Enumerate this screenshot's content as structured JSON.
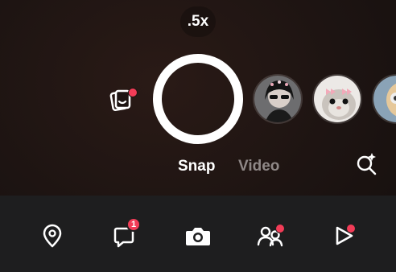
{
  "camera": {
    "zoom_label": ".5x",
    "modes": {
      "snap": "Snap",
      "video": "Video",
      "active": "Snap"
    }
  },
  "lenses": [
    {
      "name": "lens-thumbnail-girl-sunglasses"
    },
    {
      "name": "lens-thumbnail-hamster-bows"
    },
    {
      "name": "lens-thumbnail-partial"
    }
  ],
  "nav": {
    "items": [
      {
        "name": "map",
        "icon": "location-pin-icon"
      },
      {
        "name": "chat",
        "icon": "chat-bubble-icon",
        "badge": "1"
      },
      {
        "name": "camera",
        "icon": "camera-icon"
      },
      {
        "name": "stories",
        "icon": "friends-icon"
      },
      {
        "name": "spotlight",
        "icon": "play-icon"
      }
    ]
  },
  "colors": {
    "accent_red": "#f23c57",
    "navbar_bg": "#1e1e1f",
    "inactive_text": "#8f8887"
  }
}
